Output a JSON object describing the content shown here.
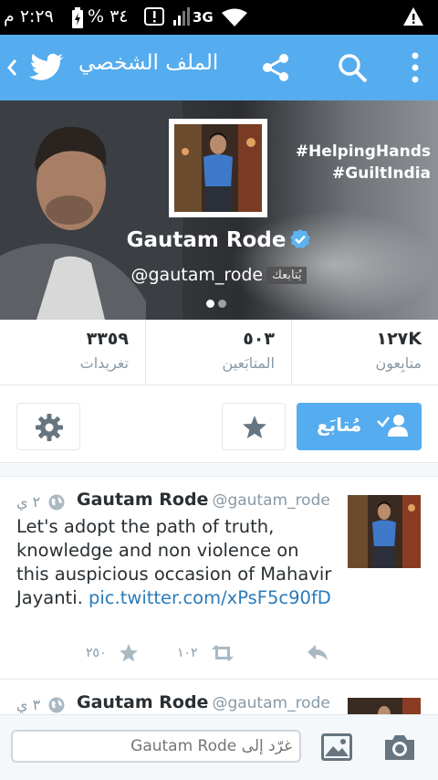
{
  "status_bar": {
    "clock": "٢:٢٩ م",
    "battery_percent": "٣٤ %",
    "network": "3G",
    "icons": [
      "warning-icon",
      "wifi-icon",
      "signal-icon",
      "notification-icon",
      "battery-charging-icon"
    ]
  },
  "app_bar": {
    "title": "الملف الشخصي",
    "icons": [
      "overflow-menu-icon",
      "search-icon",
      "share-icon",
      "twitter-bird-icon",
      "back-chevron-icon"
    ],
    "color": "#55acee"
  },
  "profile": {
    "name": "Gautam Rode",
    "handle": "@gautam_rode",
    "follows_you_badge": "يُتابعك",
    "hashtags": [
      "#HelpingHands",
      "#GuiltIndia"
    ],
    "verified": true,
    "pager_active_index": 0
  },
  "stats": {
    "tweets": {
      "value": "٣٣٥٩",
      "label": "تغريدات"
    },
    "following": {
      "value": "٥٠٣",
      "label": "المتابَعين"
    },
    "followers": {
      "value": "١٢٧K",
      "label": "متابِعون"
    }
  },
  "actions": {
    "follow_label": "مُتابَع",
    "icons": [
      "settings-gear-icon",
      "star-icon",
      "following-user-icon"
    ]
  },
  "tweets": [
    {
      "author": "Gautam Rode",
      "handle": "@gautam_rode",
      "time": "٢ ي",
      "text": "Let's adopt the path of truth, knowledge and non violence on this auspicious occasion of Mahavir Jayanti.",
      "link": "pic.twitter.com/xPsF5c90fD",
      "retweets": "١٠٢",
      "favorites": "٢٥٠"
    },
    {
      "author": "Gautam Rode",
      "handle": "@gautam_rode",
      "time": "٣ ي"
    }
  ],
  "composer": {
    "placeholder": "غرّد إلى Gautam Rode",
    "icons": [
      "image-icon",
      "camera-icon"
    ]
  }
}
